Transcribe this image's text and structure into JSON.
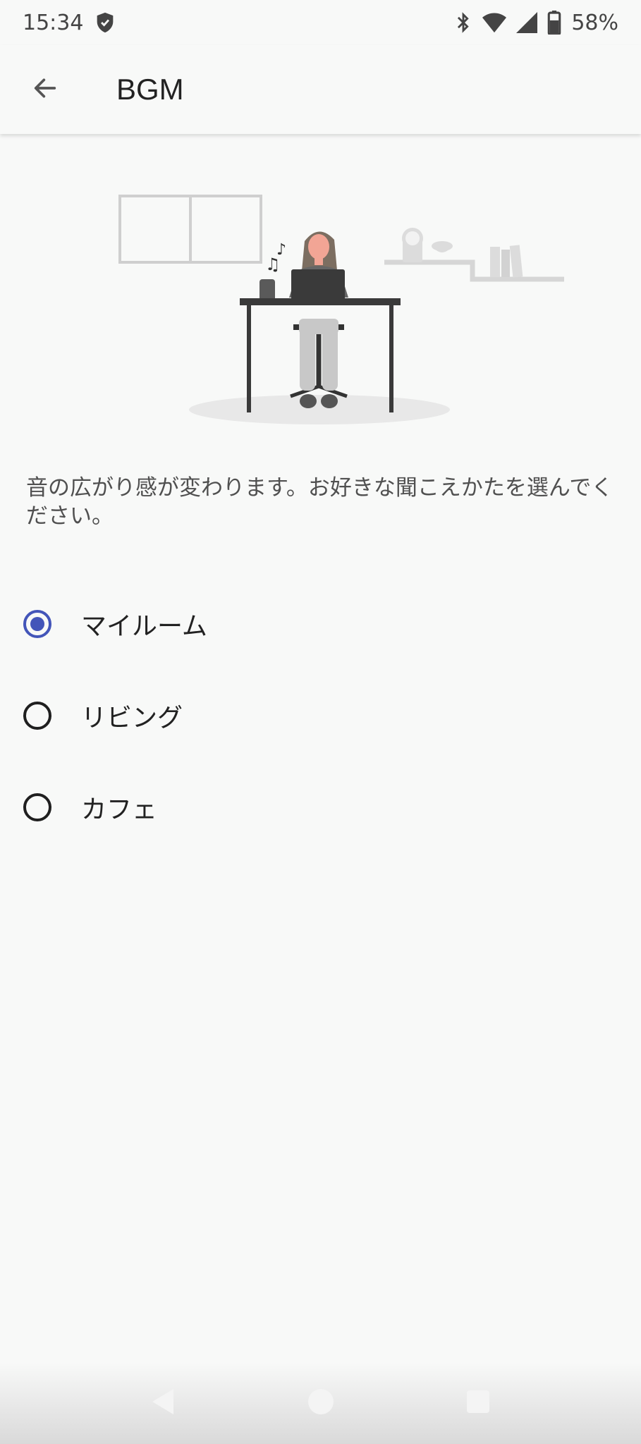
{
  "status_bar": {
    "time": "15:34",
    "battery": "58%"
  },
  "app_bar": {
    "title": "BGM"
  },
  "description": "音の広がり感が変わります。お好きな聞こえかたを選んでください。",
  "options": [
    {
      "label": "マイルーム",
      "selected": true
    },
    {
      "label": "リビング",
      "selected": false
    },
    {
      "label": "カフェ",
      "selected": false
    }
  ],
  "colors": {
    "accent": "#4355b9",
    "background": "#f8f9f8"
  }
}
